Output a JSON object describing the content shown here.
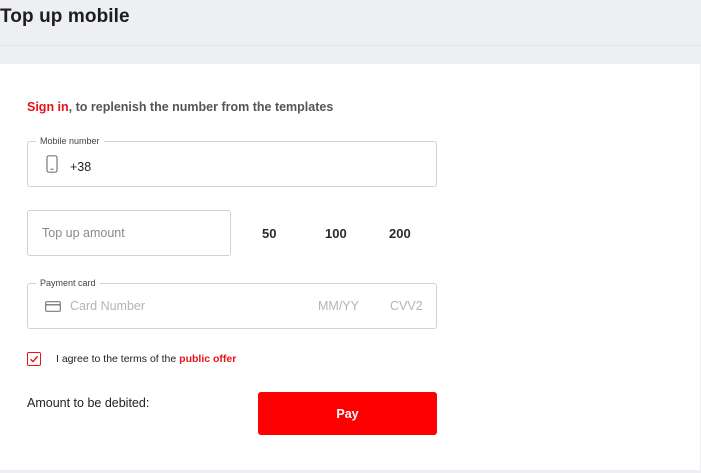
{
  "header": {
    "title": "Top up mobile"
  },
  "signin": {
    "link_label": "Sign in",
    "rest_text": ", to replenish the number from the templates"
  },
  "mobile": {
    "legend": "Mobile number",
    "icon": "phone-icon",
    "value": "+38"
  },
  "amount": {
    "placeholder": "Top up amount",
    "presets": [
      "50",
      "100",
      "200"
    ]
  },
  "payment_card": {
    "legend": "Payment card",
    "icon": "credit-card-icon",
    "card_number_placeholder": "Card Number",
    "expiry_placeholder": "MM/YY",
    "cvv_placeholder": "CVV2"
  },
  "terms": {
    "checked": true,
    "text": "I agree to the terms of the ",
    "link_label": "public offer"
  },
  "debit": {
    "label": "Amount to be debited:"
  },
  "pay_button": {
    "label": "Pay"
  },
  "colors": {
    "accent": "#e8121c",
    "pay_button": "#ff0000",
    "background": "#eeeff2"
  }
}
